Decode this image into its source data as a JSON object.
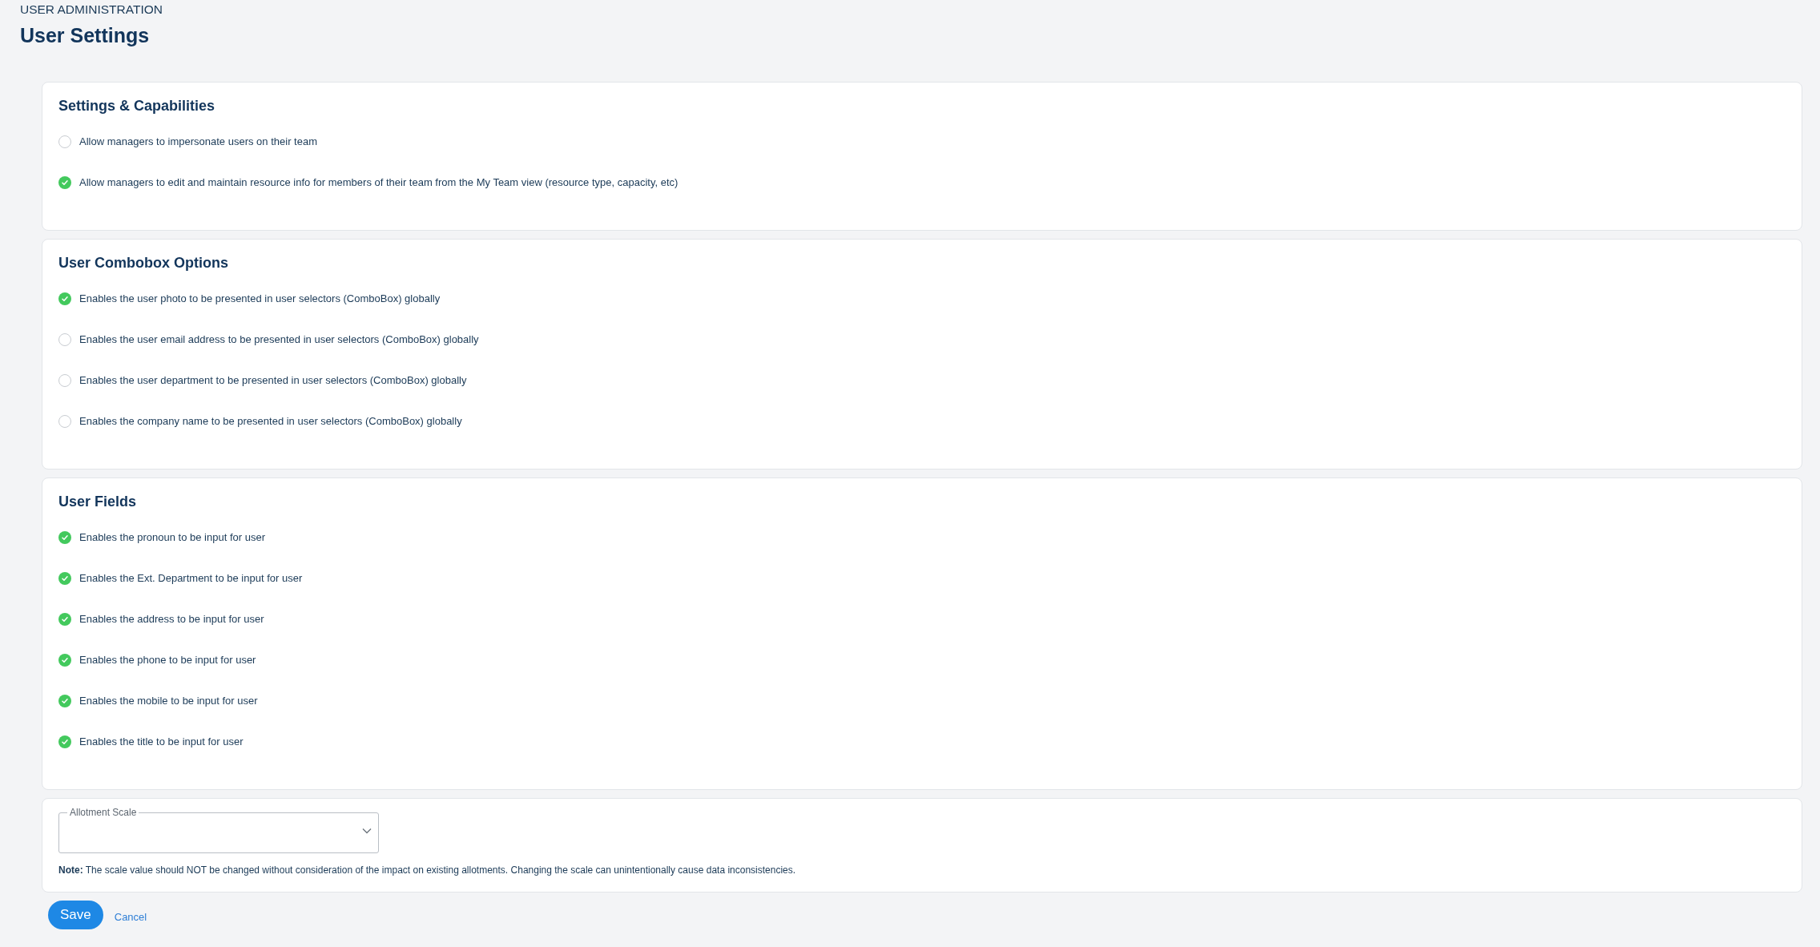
{
  "breadcrumb": "USER ADMINISTRATION",
  "title": "User Settings",
  "sections": [
    {
      "heading": "Settings & Capabilities",
      "options": [
        {
          "label": "Allow managers to impersonate users on their team",
          "checked": false
        },
        {
          "label": "Allow managers to edit and maintain resource info for members of their team from the My Team view (resource type, capacity, etc)",
          "checked": true
        }
      ]
    },
    {
      "heading": "User Combobox Options",
      "options": [
        {
          "label": "Enables the user photo to be presented in user selectors (ComboBox) globally",
          "checked": true
        },
        {
          "label": "Enables the user email address to be presented in user selectors (ComboBox) globally",
          "checked": false
        },
        {
          "label": "Enables the user department to be presented in user selectors (ComboBox) globally",
          "checked": false
        },
        {
          "label": "Enables the company name to be presented in user selectors (ComboBox) globally",
          "checked": false
        }
      ]
    },
    {
      "heading": "User Fields",
      "options": [
        {
          "label": "Enables the pronoun to be input for user",
          "checked": true
        },
        {
          "label": "Enables the Ext. Department to be input for user",
          "checked": true
        },
        {
          "label": "Enables the address to be input for user",
          "checked": true
        },
        {
          "label": "Enables the phone to be input for user",
          "checked": true
        },
        {
          "label": "Enables the mobile to be input for user",
          "checked": true
        },
        {
          "label": "Enables the title to be input for user",
          "checked": true
        }
      ]
    }
  ],
  "allotment": {
    "label": "Allotment Scale",
    "note": "**Note:** The scale value should NOT be changed without consideration of the impact on existing allotments. Changing the scale can unintentionally cause data inconsistencies."
  },
  "buttons": {
    "save": "Save",
    "cancel": "Cancel"
  }
}
